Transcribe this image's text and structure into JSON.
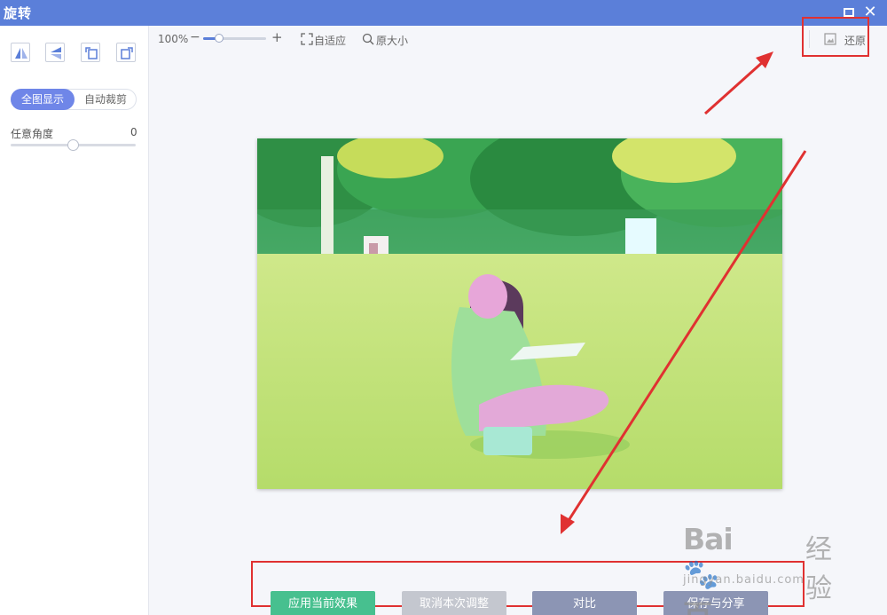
{
  "window": {
    "title": "旋转"
  },
  "sidebar": {
    "tools": [
      {
        "icon": "flip-horizontal-icon"
      },
      {
        "icon": "flip-vertical-icon"
      },
      {
        "icon": "rotate-left-icon"
      },
      {
        "icon": "rotate-right-icon"
      }
    ],
    "display_modes": [
      "全图显示",
      "自动裁剪"
    ],
    "active_mode": "全图显示",
    "angle_label": "任意角度",
    "angle_value": "0"
  },
  "toolbar": {
    "zoom_label": "100%",
    "zoom_minus": "−",
    "zoom_plus": "+",
    "fit_label": "自适应",
    "original_label": "原大小",
    "restore_label": "还原"
  },
  "actions": {
    "apply_label": "应用当前效果",
    "cancel_label": "取消本次调整",
    "compare_label": "对比",
    "save_label": "保存与分享"
  },
  "watermark": {
    "logo": "Bai🐾百",
    "cn": "经验",
    "url": "jingyan.baidu.com"
  },
  "colors": {
    "titlebar": "#5b7fd9",
    "active_mode": "#6f86e8",
    "apply": "#47c08f",
    "cancel": "#c4c7cf",
    "compare": "#8c95b4",
    "save": "#8c95b4",
    "annotation": "#e03131"
  }
}
